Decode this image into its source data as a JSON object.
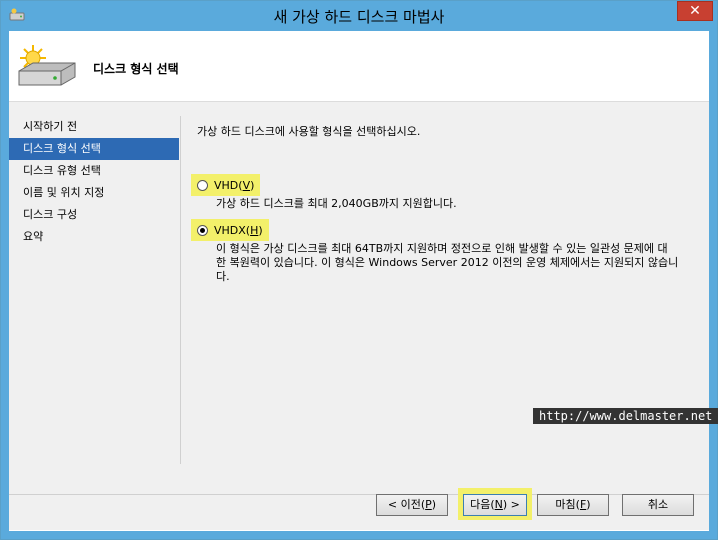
{
  "window": {
    "title": "새 가상 하드 디스크 마법사",
    "close_glyph": "✕"
  },
  "header": {
    "title": "디스크 형식 선택"
  },
  "nav": {
    "items": [
      {
        "label": "시작하기 전",
        "active": false
      },
      {
        "label": "디스크 형식 선택",
        "active": true
      },
      {
        "label": "디스크 유형 선택",
        "active": false
      },
      {
        "label": "이름 및 위치 지정",
        "active": false
      },
      {
        "label": "디스크 구성",
        "active": false
      },
      {
        "label": "요약",
        "active": false
      }
    ]
  },
  "content": {
    "intro": "가상 하드 디스크에 사용할 형식을 선택하십시오.",
    "options": [
      {
        "label_text": "VHD(",
        "mnemonic": "V",
        "label_end": ")",
        "checked": false,
        "description": "가상 하드 디스크를 최대 2,040GB까지 지원합니다."
      },
      {
        "label_text": "VHDX(",
        "mnemonic": "H",
        "label_end": ")",
        "checked": true,
        "description_line1": "이 형식은 가상 디스크를 최대 64TB까지 지원하며 정전으로 인해 발생할 수 있는 일관성 문제에 대",
        "description_line2": "한 복원력이 있습니다. 이 형식은 Windows Server 2012 이전의 운영 체제에서는 지원되지 않습니",
        "description_line3": "다."
      }
    ]
  },
  "watermark": "http://www.delmaster.net",
  "buttons": {
    "prev": {
      "pre": "< 이전(",
      "key": "P",
      "post": ")"
    },
    "next": {
      "pre": "다음(",
      "key": "N",
      "post": ") >"
    },
    "finish": {
      "pre": "마침(",
      "key": "F",
      "post": ")"
    },
    "cancel": {
      "label": "취소"
    }
  },
  "colors": {
    "titlebar": "#5aaadc",
    "active_nav": "#2d6ab4",
    "highlight": "#f3f06a",
    "close": "#c84031"
  }
}
